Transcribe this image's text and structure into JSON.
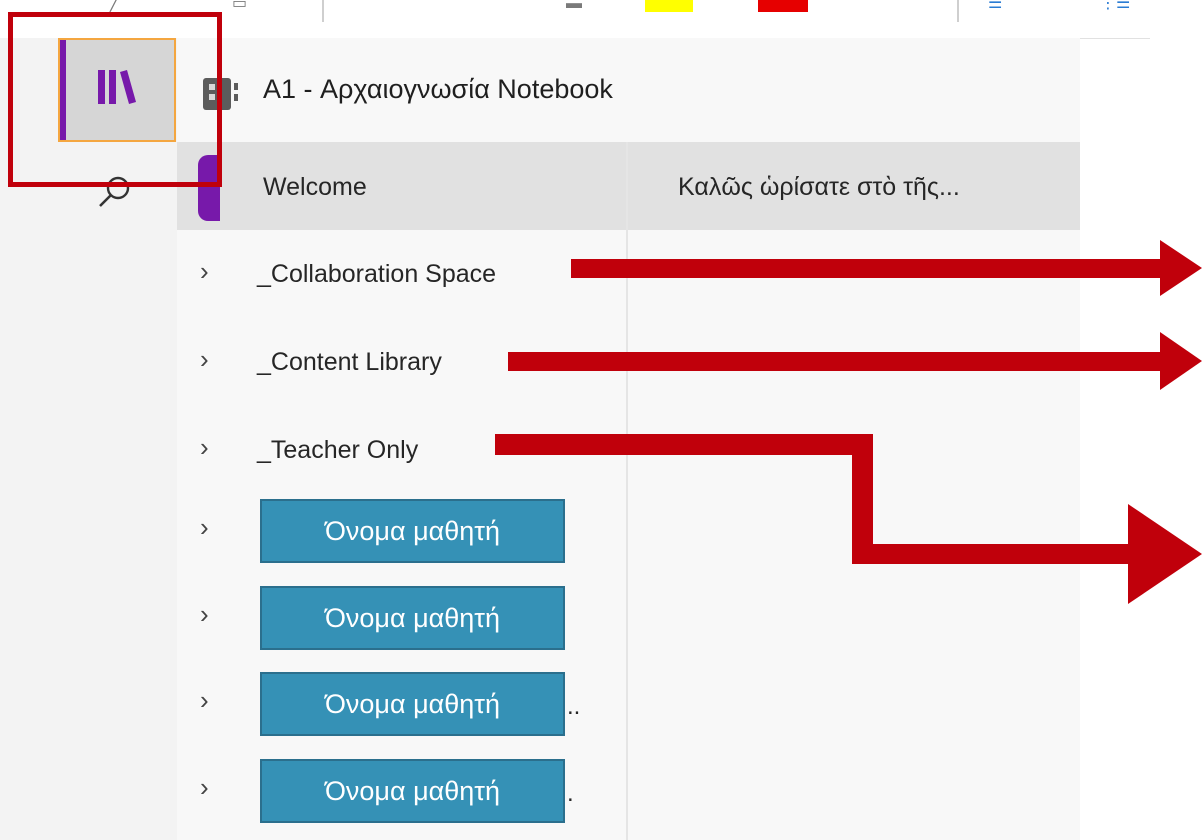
{
  "notebook": {
    "title": "A1 - Αρχαιογνωσία Notebook"
  },
  "rail": {
    "notebooks_icon": "library-books-icon",
    "search_icon": "search-icon"
  },
  "toolbar": {
    "highlight_yellow": "#ffff00",
    "highlight_red": "#e60000"
  },
  "welcome": {
    "label": "Welcome",
    "page_title": "Καλῶς ὡρίσατε στὸ τῆς..."
  },
  "sections": [
    {
      "label": "_Collaboration Space"
    },
    {
      "label": "_Content Library"
    },
    {
      "label": "_Teacher Only"
    }
  ],
  "students": [
    {
      "label": "Όνομα μαθητή",
      "trail": ""
    },
    {
      "label": "Όνομα μαθητή",
      "trail": ""
    },
    {
      "label": "Όνομα μαθητή",
      "trail": ".."
    },
    {
      "label": "Όνομα μαθητή",
      "trail": "."
    }
  ],
  "colors": {
    "accent_purple": "#7719aa",
    "annotation_red": "#c0000b",
    "student_tag_blue": "#3591b6"
  }
}
